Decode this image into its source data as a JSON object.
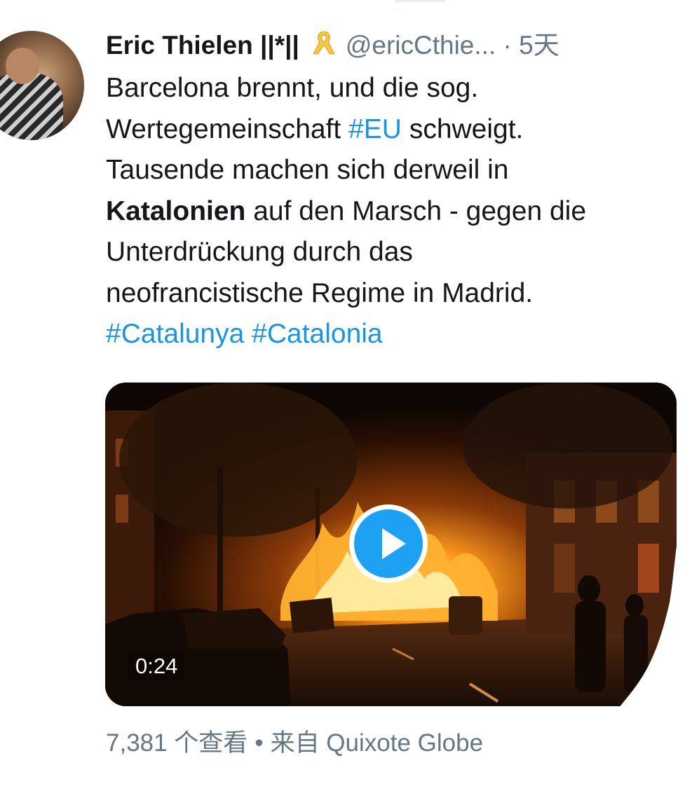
{
  "tweet": {
    "author_name": "Eric Thielen ||*||",
    "handle": "@ericCthie...",
    "separator": "·",
    "time": "5天",
    "text_parts": [
      {
        "text": "Barcelona brennt, und die sog.",
        "style": "plain"
      },
      {
        "text": "Wertegemeinschaft ",
        "style": "plain"
      },
      {
        "text": "#EU",
        "style": "hashtag"
      },
      {
        "text": " schweigt.",
        "style": "plain"
      },
      {
        "text": "Tausende machen sich derweil in",
        "style": "plain"
      },
      {
        "text": "Katalonien",
        "style": "bold"
      },
      {
        "text": " auf den Marsch - gegen die",
        "style": "plain"
      },
      {
        "text": "Unterdrückung durch das",
        "style": "plain"
      },
      {
        "text": "neofrancistische Regime in Madrid.",
        "style": "plain"
      },
      {
        "text": "#Catalunya",
        "style": "hashtag"
      },
      {
        "text": " ",
        "style": "plain"
      },
      {
        "text": "#Catalonia",
        "style": "hashtag"
      }
    ]
  },
  "media": {
    "duration": "0:24",
    "play_icon": "play-icon"
  },
  "meta": {
    "views": "7,381 个查看",
    "dot": "•",
    "source": "来自 Quixote Globe"
  },
  "colors": {
    "link": "#1b95e0",
    "play_button": "#1da1f2",
    "secondary_text": "#657786",
    "primary_text": "#14171a"
  }
}
